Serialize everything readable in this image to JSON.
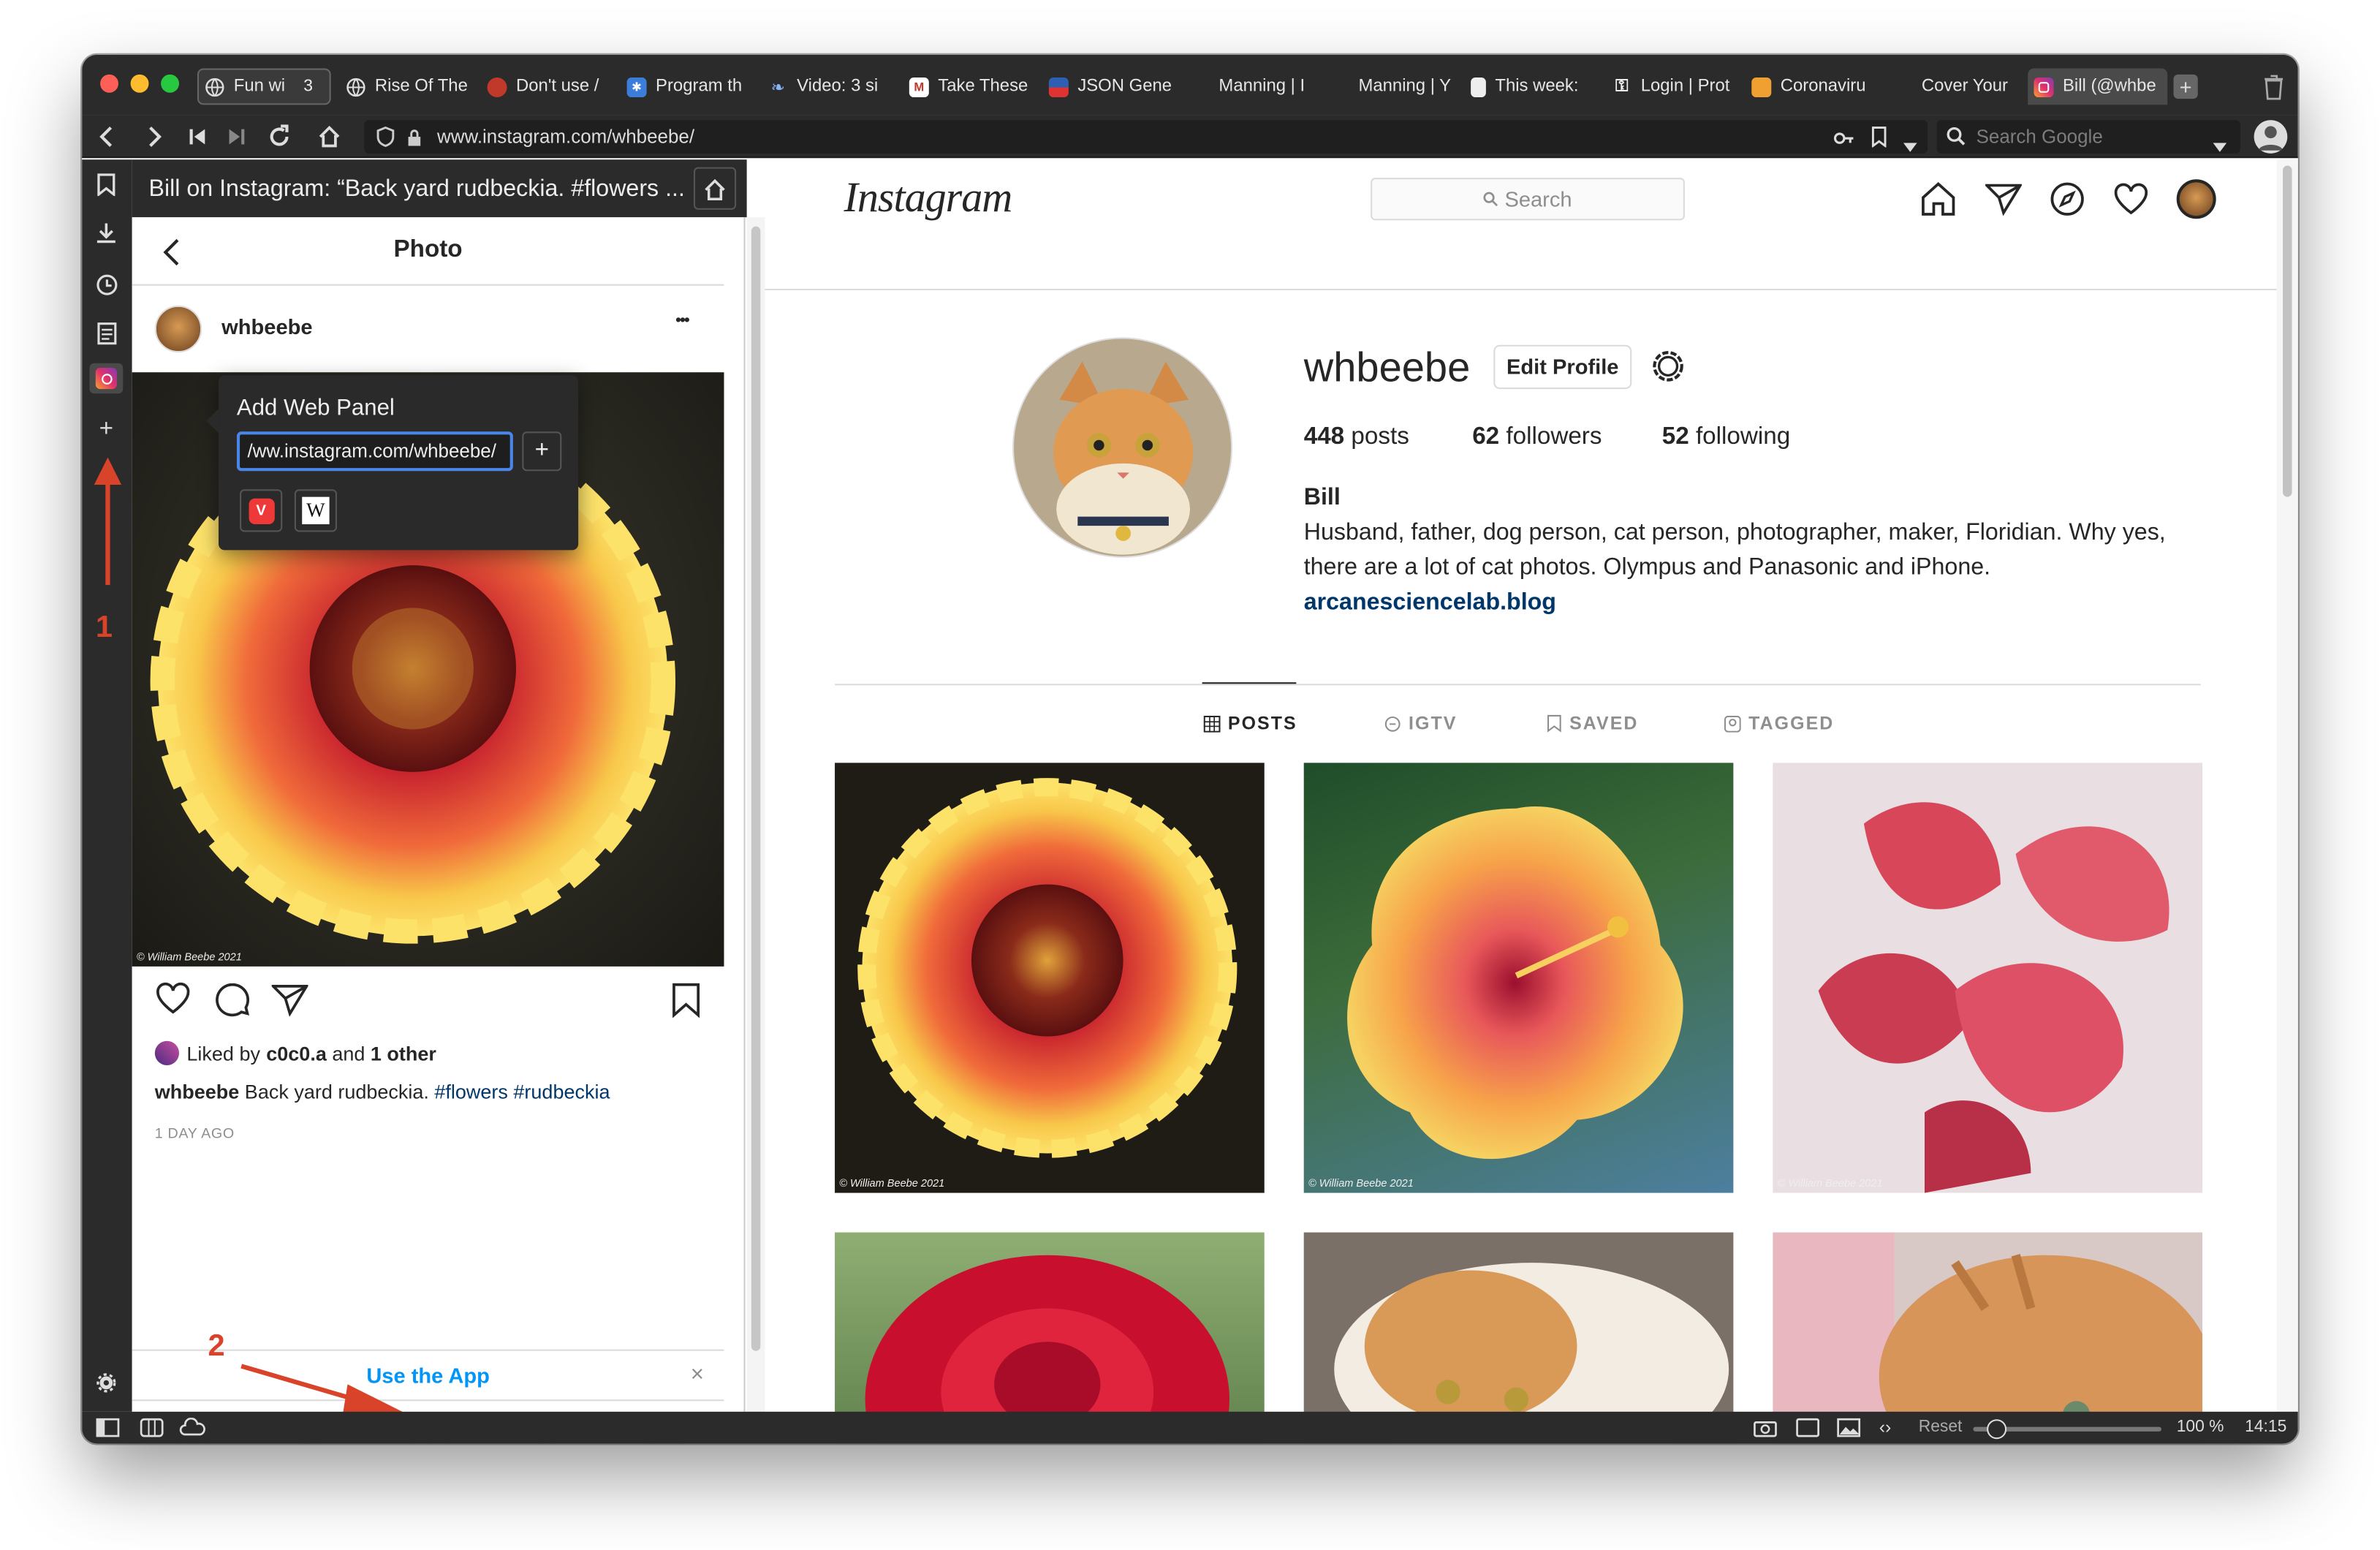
{
  "tabs": [
    {
      "label": "Fun wi",
      "count": "3",
      "favicon": "globe-icon"
    },
    {
      "label": "Rise Of The",
      "favicon": "globe-icon"
    },
    {
      "label": "Don't use /",
      "favicon": "tomato-icon"
    },
    {
      "label": "Program th",
      "favicon": "snowflake-icon"
    },
    {
      "label": "Video: 3 si",
      "favicon": "feather-icon"
    },
    {
      "label": "Take These",
      "favicon": "m-icon"
    },
    {
      "label": "JSON Gene",
      "favicon": "flag-icon"
    },
    {
      "label": "Manning | I",
      "favicon": "blank-icon"
    },
    {
      "label": "Manning | Y",
      "favicon": "blank-icon"
    },
    {
      "label": "This week:",
      "favicon": "doc-icon"
    },
    {
      "label": "Login | Prot",
      "favicon": "lock-icon"
    },
    {
      "label": "Coronaviru",
      "favicon": "package-icon"
    },
    {
      "label": "Cover Your",
      "favicon": "blank-icon"
    },
    {
      "label": "Bill (@whbe",
      "favicon": "instagram-icon"
    }
  ],
  "address": {
    "url": "www.instagram.com/whbeebe/",
    "search_placeholder": "Search Google"
  },
  "panel": {
    "title": "Bill on Instagram: “Back yard rudbeckia. #flowers ...",
    "photo_header": "Photo",
    "username": "whbeebe",
    "copyright": "© William Beebe 2021",
    "liked_by_prefix": "Liked by ",
    "liked_user": "c0c0.a",
    "liked_and": " and ",
    "liked_other": "1 other",
    "caption_user": "whbeebe",
    "caption_text": " Back yard rudbeckia. ",
    "caption_tags": "#flowers #rudbeckia",
    "time": "1 DAY AGO",
    "use_app": "Use the App",
    "more": "•••"
  },
  "popup": {
    "title": "Add Web Panel",
    "input_value": "/ww.instagram.com/whbeebe/",
    "add_button": "+",
    "presets": [
      "vivaldi-icon",
      "wikipedia-icon"
    ]
  },
  "annotations": {
    "marker1": "1",
    "marker2": "2"
  },
  "instagram": {
    "logo": "Instagram",
    "search_placeholder": "Search",
    "username": "whbeebe",
    "edit_profile": "Edit Profile",
    "posts_count": "448",
    "posts_label": " posts",
    "followers_count": "62",
    "followers_label": " followers",
    "following_count": "52",
    "following_label": " following",
    "display_name": "Bill",
    "bio_line1": "Husband, father, dog person, cat person, photographer, maker, Floridian. Why yes,",
    "bio_line2": "there are a lot of cat photos. Olympus and Panasonic and iPhone.",
    "website": "arcanesciencelab.blog",
    "tabs": [
      "POSTS",
      "IGTV",
      "SAVED",
      "TAGGED"
    ],
    "grid_copyright": "© William Beebe 2021"
  },
  "status": {
    "reset": "Reset",
    "zoom": "100 %",
    "time": "14:15",
    "zoom_level": 0.12
  },
  "colors": {
    "chrome": "#2b2b2b",
    "link": "#00376b",
    "tag": "#00376b",
    "annotation": "#d8432a",
    "accent": "#0095f6"
  }
}
